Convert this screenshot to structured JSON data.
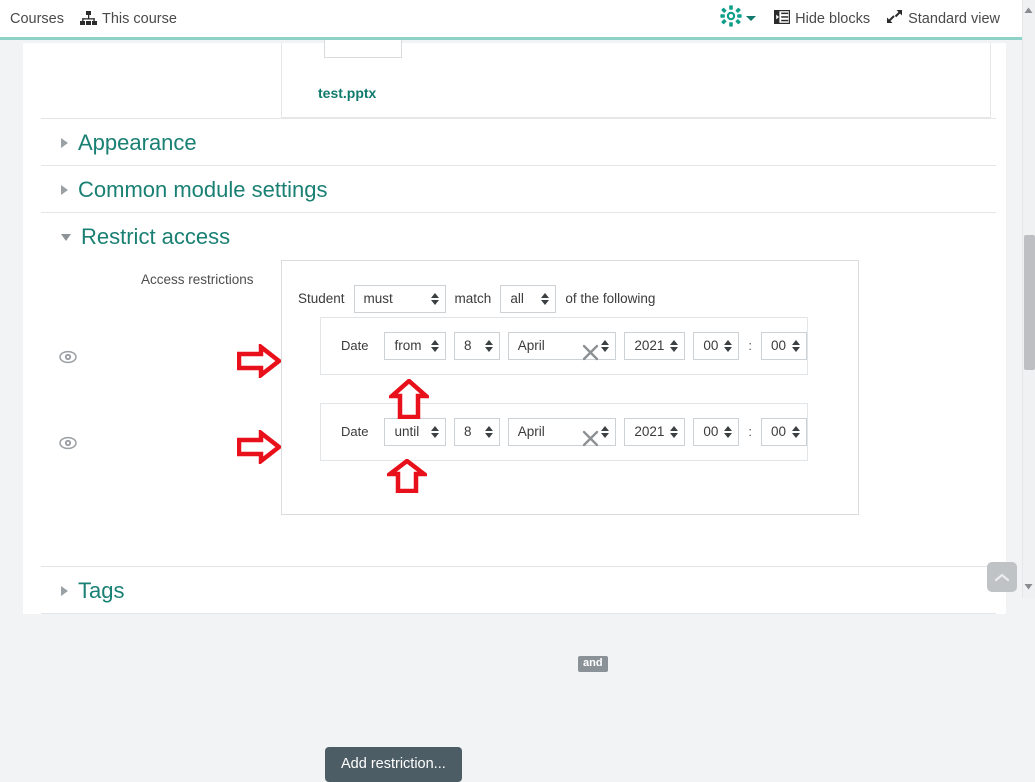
{
  "navbar": {
    "left_items": [
      {
        "label": "Courses",
        "icon": ""
      },
      {
        "label": "This course",
        "icon": "sitemap-icon"
      }
    ],
    "gear": {
      "icon": "gear-icon",
      "caret": "chevron-down-icon",
      "color": "#0f7a6c"
    },
    "right_items": [
      {
        "label": "Hide blocks",
        "icon": "collapse-panel-icon"
      },
      {
        "label": "Standard view",
        "icon": "resize-arrows-icon"
      }
    ]
  },
  "file_area": {
    "file_name": "test.pptx",
    "thumb_icon": "powerpoint-file-icon"
  },
  "sections": [
    {
      "title": "Appearance",
      "expanded": false
    },
    {
      "title": "Common module settings",
      "expanded": false
    },
    {
      "title": "Restrict access",
      "expanded": true
    },
    {
      "title": "Tags",
      "expanded": false
    }
  ],
  "restrict_access": {
    "field_label": "Access restrictions",
    "match_sentence": {
      "prefix": "Student",
      "must_value": "must",
      "middle": "match",
      "all_value": "all",
      "suffix": "of the following"
    },
    "operator_badge": "and",
    "rules": [
      {
        "label": "Date",
        "eye_icon": "eye-icon",
        "direction": "from",
        "day": "8",
        "month": "April",
        "year": "2021",
        "hour": "00",
        "time_separator": ":",
        "minute": "00",
        "delete_icon": "close-x-icon"
      },
      {
        "label": "Date",
        "eye_icon": "eye-icon",
        "direction": "until",
        "day": "8",
        "month": "April",
        "year": "2021",
        "hour": "00",
        "time_separator": ":",
        "minute": "00",
        "delete_icon": "close-x-icon"
      }
    ],
    "add_button_label": "Add restriction...",
    "add_button_color": "#4d5d65"
  },
  "annotations": [
    {
      "name": "arrow-right-eye-1",
      "shape": "arrow-right",
      "color": "#e8101a"
    },
    {
      "name": "arrow-right-eye-2",
      "shape": "arrow-right",
      "color": "#e8101a"
    },
    {
      "name": "arrow-up-from-select",
      "shape": "arrow-up",
      "color": "#e8101a"
    },
    {
      "name": "arrow-up-until-select",
      "shape": "arrow-up",
      "color": "#e8101a"
    }
  ],
  "scroll_to_top": {
    "icon": "chevron-up-icon"
  },
  "theme": {
    "accent_teal": "#1a8074",
    "navbar_underline": "#8ed1c7",
    "page_bg": "#f2f3f5"
  }
}
